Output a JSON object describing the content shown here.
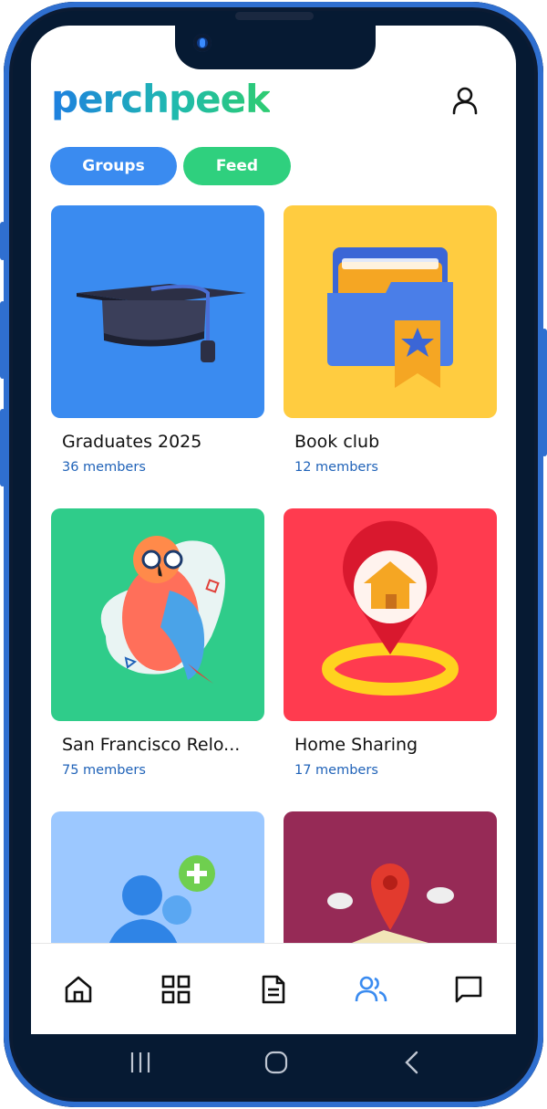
{
  "app": {
    "logo_text": "perchpeek"
  },
  "tabs": {
    "groups_label": "Groups",
    "feed_label": "Feed"
  },
  "groups": [
    {
      "title": "Graduates 2025",
      "members": "36 members",
      "color": "#3a8bf0",
      "icon": "graduation-cap-icon"
    },
    {
      "title": "Book club",
      "members": "12 members",
      "color": "#ffcc40",
      "icon": "folder-star-icon"
    },
    {
      "title": "San Francisco Relo...",
      "members": "75 members",
      "color": "#2fcc8a",
      "icon": "parrot-icon"
    },
    {
      "title": "Home Sharing",
      "members": "17 members",
      "color": "#ff3b4f",
      "icon": "home-pin-icon"
    },
    {
      "title": "",
      "members": "",
      "color": "#9cc8ff",
      "icon": "add-people-icon"
    },
    {
      "title": "",
      "members": "",
      "color": "#962a56",
      "icon": "map-pin-icon"
    }
  ],
  "bottom_nav": [
    "home-icon",
    "grid-icon",
    "document-icon",
    "people-icon",
    "chat-icon"
  ],
  "colors": {
    "accent": "#3a8bf0",
    "green": "#2fd07e",
    "member_text": "#1f62b8",
    "active_nav": "#3a8bf0"
  }
}
